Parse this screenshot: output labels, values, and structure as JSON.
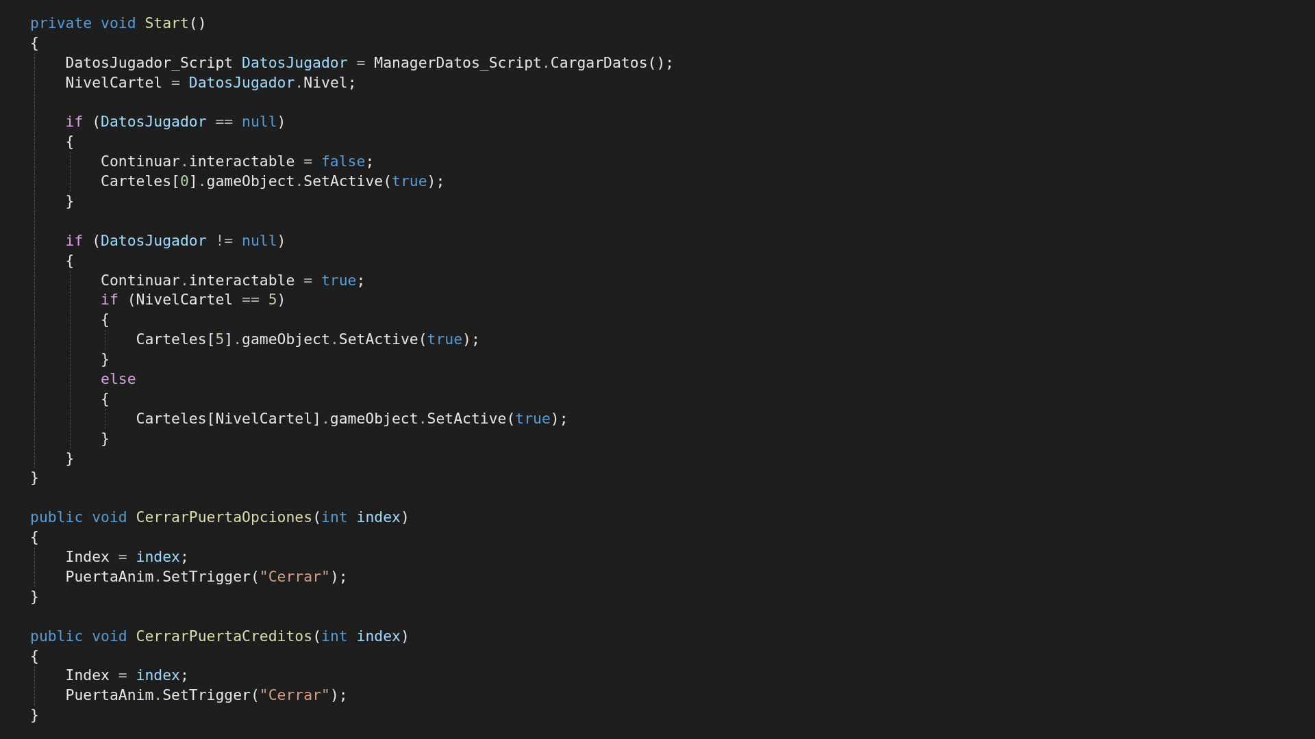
{
  "code_lines": [
    {
      "kind": "code",
      "tokens": [
        {
          "text": "private void ",
          "kind": "kw"
        },
        {
          "text": "Start",
          "kind": "method"
        },
        {
          "text": "()",
          "kind": "text"
        }
      ]
    },
    {
      "kind": "code",
      "tokens": [
        {
          "text": "{",
          "kind": "text"
        }
      ],
      "children": [
        {
          "kind": "code",
          "tokens": [
            {
              "text": "DatosJugador_Script ",
              "kind": "text"
            },
            {
              "text": "DatosJugador",
              "kind": "var"
            },
            {
              "text": " = ",
              "kind": "punct"
            },
            {
              "text": "ManagerDatos_Script",
              "kind": "text"
            },
            {
              "text": ".",
              "kind": "punct"
            },
            {
              "text": "CargarDatos",
              "kind": "text"
            },
            {
              "text": "();",
              "kind": "text"
            }
          ]
        },
        {
          "kind": "code",
          "tokens": [
            {
              "text": "NivelCartel",
              "kind": "text"
            },
            {
              "text": " = ",
              "kind": "punct"
            },
            {
              "text": "DatosJugador",
              "kind": "var"
            },
            {
              "text": ".",
              "kind": "punct"
            },
            {
              "text": "Nivel;",
              "kind": "text"
            }
          ]
        },
        {
          "kind": "blank"
        },
        {
          "kind": "code",
          "tokens": [
            {
              "text": "if",
              "kind": "ctrl"
            },
            {
              "text": " (",
              "kind": "text"
            },
            {
              "text": "DatosJugador",
              "kind": "var"
            },
            {
              "text": " == ",
              "kind": "punct"
            },
            {
              "text": "null",
              "kind": "kw"
            },
            {
              "text": ")",
              "kind": "text"
            }
          ]
        },
        {
          "kind": "code",
          "tokens": [
            {
              "text": "{",
              "kind": "text"
            }
          ],
          "children": [
            {
              "kind": "code",
              "tokens": [
                {
                  "text": "Continuar",
                  "kind": "text"
                },
                {
                  "text": ".",
                  "kind": "punct"
                },
                {
                  "text": "interactable",
                  "kind": "text"
                },
                {
                  "text": " = ",
                  "kind": "punct"
                },
                {
                  "text": "false",
                  "kind": "kw"
                },
                {
                  "text": ";",
                  "kind": "text"
                }
              ]
            },
            {
              "kind": "code",
              "tokens": [
                {
                  "text": "Carteles[",
                  "kind": "text"
                },
                {
                  "text": "0",
                  "kind": "num"
                },
                {
                  "text": "]",
                  "kind": "text"
                },
                {
                  "text": ".",
                  "kind": "punct"
                },
                {
                  "text": "gameObject",
                  "kind": "text"
                },
                {
                  "text": ".",
                  "kind": "punct"
                },
                {
                  "text": "SetActive(",
                  "kind": "text"
                },
                {
                  "text": "true",
                  "kind": "kw"
                },
                {
                  "text": ");",
                  "kind": "text"
                }
              ]
            }
          ]
        },
        {
          "kind": "code",
          "tokens": [
            {
              "text": "}",
              "kind": "text"
            }
          ]
        },
        {
          "kind": "blank"
        },
        {
          "kind": "code",
          "tokens": [
            {
              "text": "if",
              "kind": "ctrl"
            },
            {
              "text": " (",
              "kind": "text"
            },
            {
              "text": "DatosJugador",
              "kind": "var"
            },
            {
              "text": " != ",
              "kind": "punct"
            },
            {
              "text": "null",
              "kind": "kw"
            },
            {
              "text": ")",
              "kind": "text"
            }
          ]
        },
        {
          "kind": "code",
          "tokens": [
            {
              "text": "{",
              "kind": "text"
            }
          ],
          "children": [
            {
              "kind": "code",
              "tokens": [
                {
                  "text": "Continuar",
                  "kind": "text"
                },
                {
                  "text": ".",
                  "kind": "punct"
                },
                {
                  "text": "interactable",
                  "kind": "text"
                },
                {
                  "text": " = ",
                  "kind": "punct"
                },
                {
                  "text": "true",
                  "kind": "kw"
                },
                {
                  "text": ";",
                  "kind": "text"
                }
              ]
            },
            {
              "kind": "code",
              "tokens": [
                {
                  "text": "if",
                  "kind": "ctrl"
                },
                {
                  "text": " (NivelCartel",
                  "kind": "text"
                },
                {
                  "text": " == ",
                  "kind": "punct"
                },
                {
                  "text": "5",
                  "kind": "num"
                },
                {
                  "text": ")",
                  "kind": "text"
                }
              ]
            },
            {
              "kind": "code",
              "tokens": [
                {
                  "text": "{",
                  "kind": "text"
                }
              ],
              "children": [
                {
                  "kind": "code",
                  "tokens": [
                    {
                      "text": "Carteles[",
                      "kind": "text"
                    },
                    {
                      "text": "5",
                      "kind": "num"
                    },
                    {
                      "text": "]",
                      "kind": "text"
                    },
                    {
                      "text": ".",
                      "kind": "punct"
                    },
                    {
                      "text": "gameObject",
                      "kind": "text"
                    },
                    {
                      "text": ".",
                      "kind": "punct"
                    },
                    {
                      "text": "SetActive(",
                      "kind": "text"
                    },
                    {
                      "text": "true",
                      "kind": "kw"
                    },
                    {
                      "text": ");",
                      "kind": "text"
                    }
                  ]
                }
              ]
            },
            {
              "kind": "code",
              "tokens": [
                {
                  "text": "}",
                  "kind": "text"
                }
              ]
            },
            {
              "kind": "code",
              "tokens": [
                {
                  "text": "else",
                  "kind": "ctrl"
                }
              ]
            },
            {
              "kind": "code",
              "tokens": [
                {
                  "text": "{",
                  "kind": "text"
                }
              ],
              "children": [
                {
                  "kind": "code",
                  "tokens": [
                    {
                      "text": "Carteles[NivelCartel]",
                      "kind": "text"
                    },
                    {
                      "text": ".",
                      "kind": "punct"
                    },
                    {
                      "text": "gameObject",
                      "kind": "text"
                    },
                    {
                      "text": ".",
                      "kind": "punct"
                    },
                    {
                      "text": "SetActive(",
                      "kind": "text"
                    },
                    {
                      "text": "true",
                      "kind": "kw"
                    },
                    {
                      "text": ");",
                      "kind": "text"
                    }
                  ]
                }
              ]
            },
            {
              "kind": "code",
              "tokens": [
                {
                  "text": "}",
                  "kind": "text"
                }
              ]
            }
          ]
        },
        {
          "kind": "code",
          "tokens": [
            {
              "text": "}",
              "kind": "text"
            }
          ]
        }
      ]
    },
    {
      "kind": "code",
      "tokens": [
        {
          "text": "}",
          "kind": "text"
        }
      ]
    },
    {
      "kind": "blank"
    },
    {
      "kind": "code",
      "tokens": [
        {
          "text": "public void ",
          "kind": "kw"
        },
        {
          "text": "CerrarPuertaOpciones",
          "kind": "method"
        },
        {
          "text": "(",
          "kind": "text"
        },
        {
          "text": "int ",
          "kind": "kw"
        },
        {
          "text": "index",
          "kind": "var"
        },
        {
          "text": ")",
          "kind": "text"
        }
      ]
    },
    {
      "kind": "code",
      "tokens": [
        {
          "text": "{",
          "kind": "text"
        }
      ],
      "children": [
        {
          "kind": "code",
          "tokens": [
            {
              "text": "Index",
              "kind": "text"
            },
            {
              "text": " = ",
              "kind": "punct"
            },
            {
              "text": "index",
              "kind": "var"
            },
            {
              "text": ";",
              "kind": "text"
            }
          ]
        },
        {
          "kind": "code",
          "tokens": [
            {
              "text": "PuertaAnim",
              "kind": "text"
            },
            {
              "text": ".",
              "kind": "punct"
            },
            {
              "text": "SetTrigger(",
              "kind": "text"
            },
            {
              "text": "\"Cerrar\"",
              "kind": "str"
            },
            {
              "text": ");",
              "kind": "text"
            }
          ]
        }
      ]
    },
    {
      "kind": "code",
      "tokens": [
        {
          "text": "}",
          "kind": "text"
        }
      ]
    },
    {
      "kind": "blank"
    },
    {
      "kind": "code",
      "tokens": [
        {
          "text": "public void ",
          "kind": "kw"
        },
        {
          "text": "CerrarPuertaCreditos",
          "kind": "method"
        },
        {
          "text": "(",
          "kind": "text"
        },
        {
          "text": "int ",
          "kind": "kw"
        },
        {
          "text": "index",
          "kind": "var"
        },
        {
          "text": ")",
          "kind": "text"
        }
      ]
    },
    {
      "kind": "code",
      "tokens": [
        {
          "text": "{",
          "kind": "text"
        }
      ],
      "children": [
        {
          "kind": "code",
          "tokens": [
            {
              "text": "Index",
              "kind": "text"
            },
            {
              "text": " = ",
              "kind": "punct"
            },
            {
              "text": "index",
              "kind": "var"
            },
            {
              "text": ";",
              "kind": "text"
            }
          ]
        },
        {
          "kind": "code",
          "tokens": [
            {
              "text": "PuertaAnim",
              "kind": "text"
            },
            {
              "text": ".",
              "kind": "punct"
            },
            {
              "text": "SetTrigger(",
              "kind": "text"
            },
            {
              "text": "\"Cerrar\"",
              "kind": "str"
            },
            {
              "text": ");",
              "kind": "text"
            }
          ]
        }
      ]
    },
    {
      "kind": "code",
      "tokens": [
        {
          "text": "}",
          "kind": "text"
        }
      ]
    }
  ]
}
